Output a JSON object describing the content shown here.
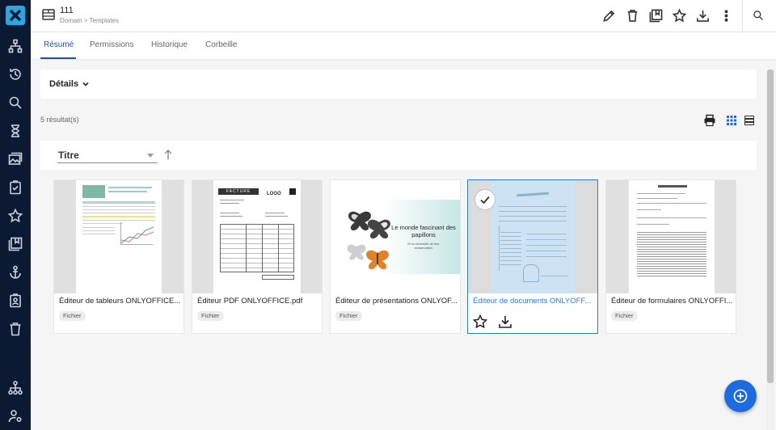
{
  "header": {
    "title": "111",
    "breadcrumb": "Domain > Templates"
  },
  "tabs": [
    {
      "label": "Résumé",
      "active": true
    },
    {
      "label": "Permissions",
      "active": false
    },
    {
      "label": "Historique",
      "active": false
    },
    {
      "label": "Corbeille",
      "active": false
    }
  ],
  "details": {
    "label": "Détails"
  },
  "results": {
    "count_text": "5 résultat(s)"
  },
  "sort": {
    "label": "Titre"
  },
  "cards": [
    {
      "title": "Éditeur de tableurs ONLYOFFICE...",
      "badge": "Fichier"
    },
    {
      "title": "Éditeur PDF ONLYOFFICE.pdf",
      "badge": "Fichier"
    },
    {
      "title": "Éditeur de présentations ONLYOF...",
      "badge": "Fichier"
    },
    {
      "title": "Éditeur de documents ONLYOFF...",
      "badge": "",
      "selected": true
    },
    {
      "title": "Éditeur de formulaires ONLYOFFI...",
      "badge": "Fichier"
    }
  ],
  "thumbs": {
    "invoice_heading": "FACTURE",
    "invoice_logo": "LOGO",
    "slide_title": "Le monde fascinant des papillons",
    "slide_subtitle": "Et la nécessité de leur conservation"
  },
  "colors": {
    "sidebar": "#0b1933",
    "accent": "#1e4fb8",
    "selected": "#2a7be4",
    "fab": "#1e6be0"
  },
  "icons": {
    "logo": "app-logo-icon",
    "fab": "add-icon"
  }
}
